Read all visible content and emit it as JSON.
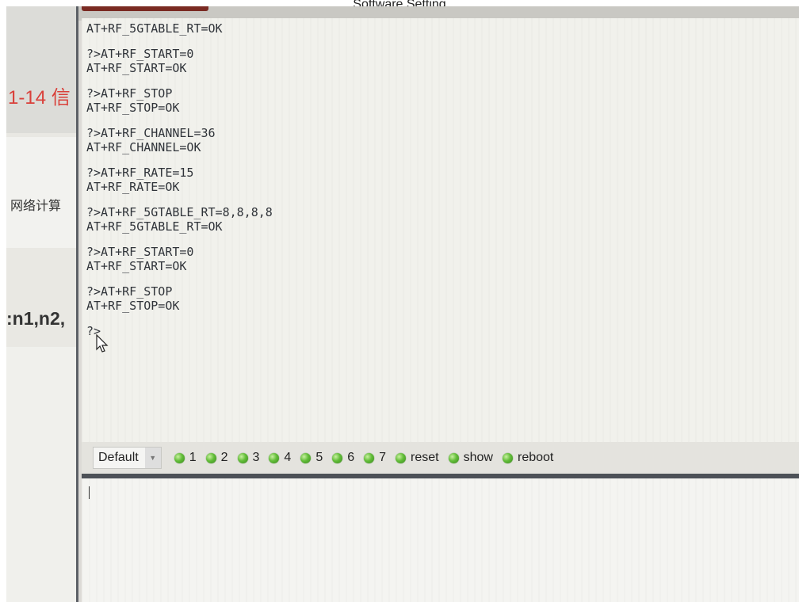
{
  "caption": "Software Setting",
  "background": {
    "red_heading": "1-14 信",
    "cn_text": "网络计算",
    "math_text": ":n1,n2,"
  },
  "console": {
    "lines": [
      "AT+RF_5GTABLE_RT=OK",
      "",
      "?>AT+RF_START=0",
      "AT+RF_START=OK",
      "",
      "?>AT+RF_STOP",
      "AT+RF_STOP=OK",
      "",
      "?>AT+RF_CHANNEL=36",
      "AT+RF_CHANNEL=OK",
      "",
      "?>AT+RF_RATE=15",
      "AT+RF_RATE=OK",
      "",
      "?>AT+RF_5GTABLE_RT=8,8,8,8",
      "AT+RF_5GTABLE_RT=OK",
      "",
      "?>AT+RF_START=0",
      "AT+RF_START=OK",
      "",
      "?>AT+RF_STOP",
      "AT+RF_STOP=OK",
      "",
      "?>"
    ]
  },
  "toolbar": {
    "profile_select": "Default",
    "buttons": [
      "1",
      "2",
      "3",
      "4",
      "5",
      "6",
      "7",
      "reset",
      "show",
      "reboot"
    ],
    "led_color": "#62bd38"
  },
  "input": {
    "value": ""
  }
}
